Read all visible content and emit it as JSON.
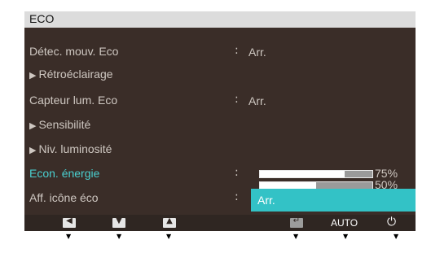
{
  "menu": {
    "title": "ECO",
    "items": [
      {
        "label": "Détec. mouv. Eco",
        "value": "Arr."
      },
      {
        "label": "Rétroéclairage"
      },
      {
        "label": "Capteur lum. Eco",
        "value": "Arr."
      },
      {
        "label": "Sensibilité"
      },
      {
        "label": "Niv. luminosité"
      },
      {
        "label": "Econ. énergie"
      },
      {
        "label": "Aff. icône éco"
      }
    ],
    "colon": ":",
    "submenu_marker": "▶"
  },
  "dropdown": {
    "options": [
      {
        "label": "75%",
        "level": 0.75
      },
      {
        "label": "50%",
        "level": 0.5
      },
      {
        "label": "Arr."
      }
    ],
    "selected": "Arr.",
    "highlight_color": "#33c2c6"
  },
  "bottom_bar": {
    "keys": [
      {
        "icon": "left-arrow-icon",
        "glyph": "◀"
      },
      {
        "icon": "down-arrow-icon",
        "glyph": "▼"
      },
      {
        "icon": "up-arrow-icon",
        "glyph": "▲"
      },
      {
        "icon": "enter-icon",
        "glyph": "↵"
      }
    ],
    "auto_label": "AUTO",
    "power_glyph": "⏻"
  },
  "pointer_glyph": "▼",
  "colors": {
    "osd_bg": "#3a2d28",
    "title_bg": "#dcdcdc",
    "text": "#cfc8c2",
    "accent": "#4ad0d0"
  }
}
